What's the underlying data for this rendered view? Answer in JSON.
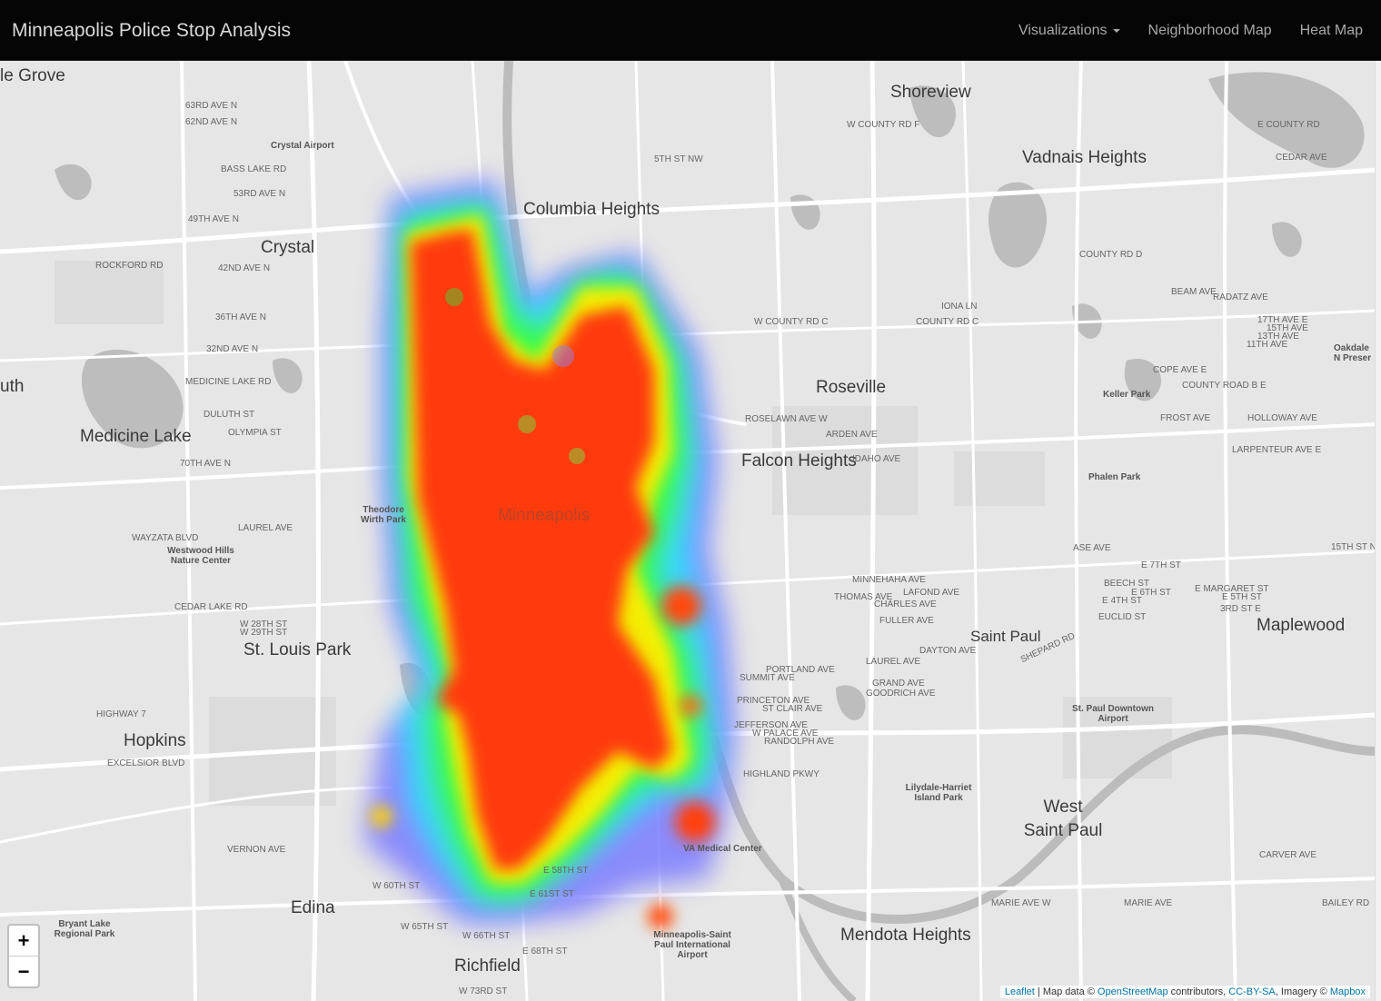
{
  "navbar": {
    "brand": "Minneapolis Police Stop Analysis",
    "links": [
      "Visualizations",
      "Neighborhood Map",
      "Heat Map"
    ]
  },
  "map": {
    "cities": [
      "Shoreview",
      "Vadnais Heights",
      "Columbia Heights",
      "Crystal",
      "Roseville",
      "Medicine Lake",
      "Falcon Heights",
      "Minneapolis",
      "St. Louis Park",
      "Saint Paul",
      "Maplewood",
      "Hopkins",
      "West Saint Paul",
      "Edina",
      "Mendota Heights",
      "Richfield",
      "le Grove",
      "uth"
    ],
    "streets": [
      "63RD AVE N",
      "62ND AVE N",
      "BASS LAKE RD",
      "53RD AVE N",
      "49TH AVE N",
      "42ND AVE N",
      "36TH AVE N",
      "32ND AVE N",
      "MEDICINE LAKE RD",
      "DULUTH ST",
      "OLYMPIA ST",
      "70TH AVE N",
      "LAUREL AVE",
      "WAYZATA BLVD",
      "CEDAR LAKE RD",
      "W 28TH ST",
      "W 29TH ST",
      "HIGHWAY 7",
      "EXCELSIOR BLVD",
      "VERNON AVE",
      "W 60TH ST",
      "W 65TH ST",
      "W 66TH ST",
      "E 68TH ST",
      "W 73RD ST",
      "E 58TH ST",
      "E 61ST ST",
      "ROCKFORD RD",
      "5TH ST NW",
      "COUNTY RD D",
      "W COUNTY RD C",
      "COUNTY RD C",
      "IONA LN",
      "ROSELAWN AVE W",
      "ARDEN AVE",
      "IDAHO AVE",
      "COPE AVE E",
      "COUNTY ROAD B E",
      "FROST AVE",
      "HOLLOWAY AVE",
      "LARPENTEUR AVE E",
      "MINNEHAHA AVE",
      "THOMAS AVE",
      "LAFOND AVE",
      "CHARLES AVE",
      "FULLER AVE",
      "DAYTON AVE",
      "LAUREL AVE",
      "PORTLAND AVE",
      "SUMMIT AVE",
      "GRAND AVE",
      "GOODRICH AVE",
      "PRINCETON AVE",
      "ST CLAIR AVE",
      "JEFFERSON AVE",
      "W PALACE AVE",
      "RANDOLPH AVE",
      "HIGHLAND PKWY",
      "E 7TH ST",
      "BEECH ST",
      "E 4TH ST",
      "E 6TH ST",
      "E MARGARET ST",
      "E 5TH ST",
      "3RD ST E",
      "EUCLID ST",
      "BEAM AVE",
      "RADATZ AVE",
      "CARVER AVE",
      "MARIE AVE W",
      "MARIE AVE",
      "BAILEY RD",
      "E COUNTY RD",
      "W COUNTY RD F",
      "CEDAR AVE",
      "15TH ST N",
      "SHEPARD RD",
      "ASE AVE",
      "17TH AVE E",
      "15TH AVE",
      "13TH AVE",
      "11TH AVE"
    ],
    "parks": [
      "Crystal Airport",
      "Theodore Wirth Park",
      "Westwood Hills Nature Center",
      "Bryant Lake Regional Park",
      "Keller Park",
      "Phalen Park",
      "St. Paul Downtown Airport",
      "Lilydale-Harriet Island Park",
      "VA Medical Center",
      "Minneapolis-Saint Paul International Airport",
      "Oakdale N Preser"
    ]
  },
  "heatmap": {
    "gradient": [
      "#0000ff",
      "#00ffff",
      "#00ff00",
      "#ffff00",
      "#ff0000"
    ]
  },
  "zoom": {
    "in": "+",
    "out": "−"
  },
  "attribution": {
    "leaflet": "Leaflet",
    "sep1": " | Map data © ",
    "osm": "OpenStreetMap",
    "contrib": " contributors, ",
    "license": "CC-BY-SA",
    "imagery": ", Imagery © ",
    "mapbox": "Mapbox"
  },
  "colors": {
    "navbar": "#050505",
    "map_background": "#e6e6e6",
    "water": "#bcbcbc",
    "road": "#ffffff",
    "link": "#0078a8"
  }
}
